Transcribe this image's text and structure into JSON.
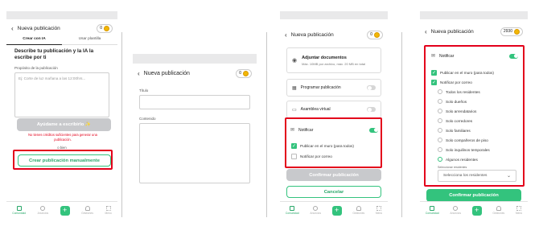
{
  "colors": {
    "accent": "#33c37d",
    "highlight": "#e3001b",
    "disabled": "#c8c9cc"
  },
  "tabbar": [
    {
      "label": "Comunidad",
      "icon": "building-icon"
    },
    {
      "label": "Anuncios",
      "icon": "chat-icon"
    },
    {
      "label": "",
      "icon": "plus-icon"
    },
    {
      "label": "Gestiones",
      "icon": "bell-icon"
    },
    {
      "label": "Menú",
      "icon": "grid-icon"
    }
  ],
  "s1": {
    "title": "Nueva publicación",
    "coins": "0",
    "tab_ai": "Crear con IA",
    "tab_template": "Usar plantilla",
    "heading": "Describe tu publicación y la IA la escribe por ti",
    "purpose_label": "Propósito de la publicación",
    "purpose_placeholder": "Ej: Corte de luz mañana a las 12:00hrs...",
    "help_button": "Ayúdame a escribirlo ✨",
    "warning": "No tienes créditos suficientes para generar una publicación.",
    "or": "o bien",
    "manual_button": "Crear publicación manualmente"
  },
  "s2": {
    "title": "Nueva publicación",
    "coins": "0",
    "title_label": "Título",
    "content_label": "Contenido"
  },
  "s3": {
    "title": "Nueva publicación",
    "coins": "0",
    "attach_title": "Adjuntar documentos",
    "attach_sub": "Máx. 10MB por archivo, máx. 20 MB en total",
    "schedule": "Programar publicación",
    "assembly": "Asamblea virtual",
    "notify": "Notificar",
    "wall": "Publicar en el muro (para todos)",
    "mail": "Notificar por correo",
    "confirm": "Confirmar publicación",
    "cancel": "Cancelar"
  },
  "s4": {
    "title": "Nueva publicación",
    "coins": "2930",
    "notify": "Notificar",
    "wall": "Publicar en el muro (para todos)",
    "mail": "Notificar por correo",
    "options": [
      "Todos los residentes",
      "Solo dueños",
      "Solo arrendatarios",
      "Solo corredores",
      "Solo familiares",
      "Solo compañeros de piso",
      "Solo inquilinos temporales",
      "Algunos residentes"
    ],
    "select_label": "Seleccionar residentes",
    "select_placeholder": "Selecciona los residentes",
    "confirm": "Confirmar publicación"
  }
}
